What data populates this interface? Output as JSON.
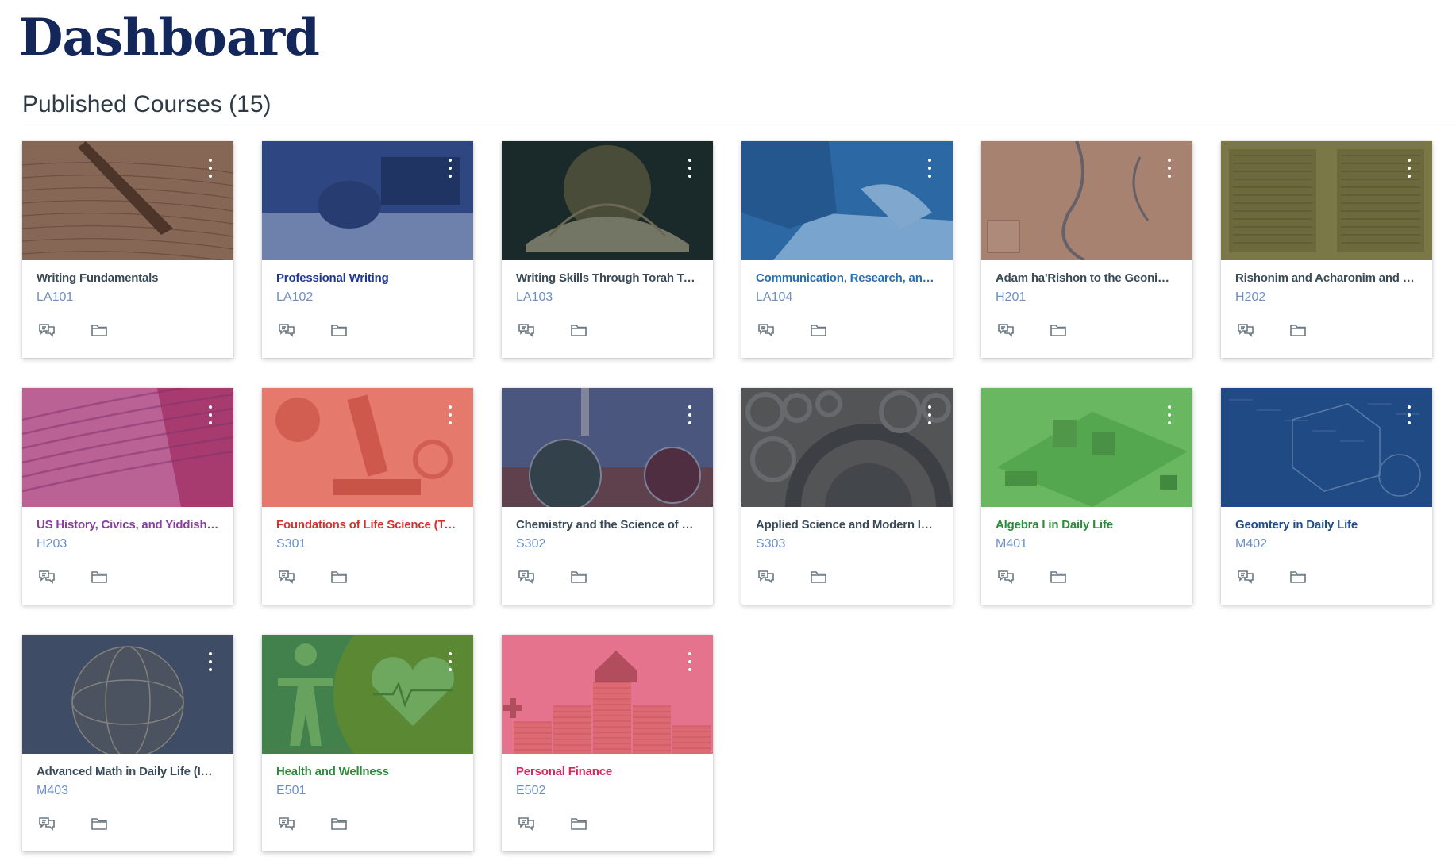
{
  "header": {
    "title": "Dashboard",
    "section_title": "Published Courses (15)"
  },
  "actions": {
    "announcements_icon": "announcements-icon",
    "files_icon": "folder-icon",
    "menu_icon": "kebab-menu-icon"
  },
  "courses": [
    {
      "title": "Writing Fundamentals",
      "code": "LA101",
      "color": "#394b58",
      "tint": "#6b4a3a",
      "art": "pen"
    },
    {
      "title": "Professional Writing",
      "code": "LA102",
      "color": "#1e3a8a",
      "tint": "#25428a",
      "art": "desk"
    },
    {
      "title": "Writing Skills Through Torah Topics",
      "code": "LA103",
      "color": "#394b58",
      "tint": "#1b2a2a",
      "art": "book"
    },
    {
      "title": "Communication, Research, and Wr...",
      "code": "LA104",
      "color": "#2a6fb0",
      "tint": "#2a6fb0",
      "art": "notebook"
    },
    {
      "title": "Adam ha'Rishon to the Geonim an...",
      "code": "H201",
      "color": "#394b58",
      "tint": "#8a5a4f",
      "art": "map"
    },
    {
      "title": "Rishonim and Acharonim and their...",
      "code": "H202",
      "color": "#394b58",
      "tint": "#6b6a38",
      "art": "manuscript"
    },
    {
      "title": "US History, Civics, and Yiddishkeit...",
      "code": "H203",
      "color": "#8a3fa0",
      "tint": "#a1407e",
      "art": "constitution"
    },
    {
      "title": "Foundations of Life Science (Topic...",
      "code": "S301",
      "color": "#d0342c",
      "tint": "#e0655a",
      "art": "microscope"
    },
    {
      "title": "Chemistry and the Science of Matt...",
      "code": "S302",
      "color": "#394b58",
      "tint": "#3b3a5a",
      "art": "chemistry"
    },
    {
      "title": "Applied Science and Modern Inno...",
      "code": "S303",
      "color": "#394b58",
      "tint": "#4a5058",
      "art": "gears"
    },
    {
      "title": "Algebra I in Daily Life",
      "code": "M401",
      "color": "#2e8b3a",
      "tint": "#5fae56",
      "art": "city"
    },
    {
      "title": "Geomtery in Daily Life",
      "code": "M402",
      "color": "#1e4f8a",
      "tint": "#1f4a85",
      "art": "geometry"
    },
    {
      "title": "Advanced Math in Daily Life (Intro...",
      "code": "M403",
      "color": "#394b58",
      "tint": "#3a4860",
      "art": "globe"
    },
    {
      "title": "Health and Wellness",
      "code": "E501",
      "color": "#2e8b3a",
      "tint": "#3e7a3a",
      "art": "health"
    },
    {
      "title": "Personal Finance",
      "code": "E502",
      "color": "#d6285a",
      "tint": "#e06a86",
      "art": "finance"
    }
  ]
}
